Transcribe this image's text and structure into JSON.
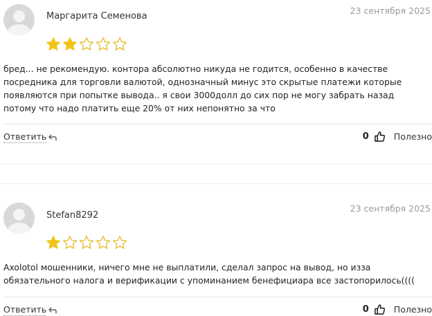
{
  "reviews": [
    {
      "author": "Маргарита Семенова",
      "date": "23 сентября 2025",
      "rating": 2,
      "max_rating": 5,
      "text": "бред... не рекомендую. контора абсолютно никуда не годится, особенно в качестве посредника для торговли валютой, однозначный минус это скрытые платежи которые появляются при попытке вывода.. я свои 3000долл до сих пор не могу забрать назад потому что надо платить еще 20% от них непонятно за что",
      "reply_label": "Ответить",
      "votes": "0",
      "useful_label": "Полезно"
    },
    {
      "author": "Stefan8292",
      "date": "23 сентября 2025",
      "rating": 1,
      "max_rating": 5,
      "text": "Axolotol мошенники, ничего мне не выплатили, сделал запрос на вывод, но изза обязательного налога и верификации с упоминанием бенефициара все застопорилось((((",
      "reply_label": "Ответить",
      "votes": "0",
      "useful_label": "Полезно"
    }
  ],
  "colors": {
    "star_filled": "#f0c419",
    "star_outline": "#e8b923",
    "divider": "#e6e6e6"
  },
  "icons": {
    "star": "star-icon",
    "reply": "reply-arrow-icon",
    "thumb": "thumbs-up-icon",
    "avatar": "user-avatar-icon"
  }
}
